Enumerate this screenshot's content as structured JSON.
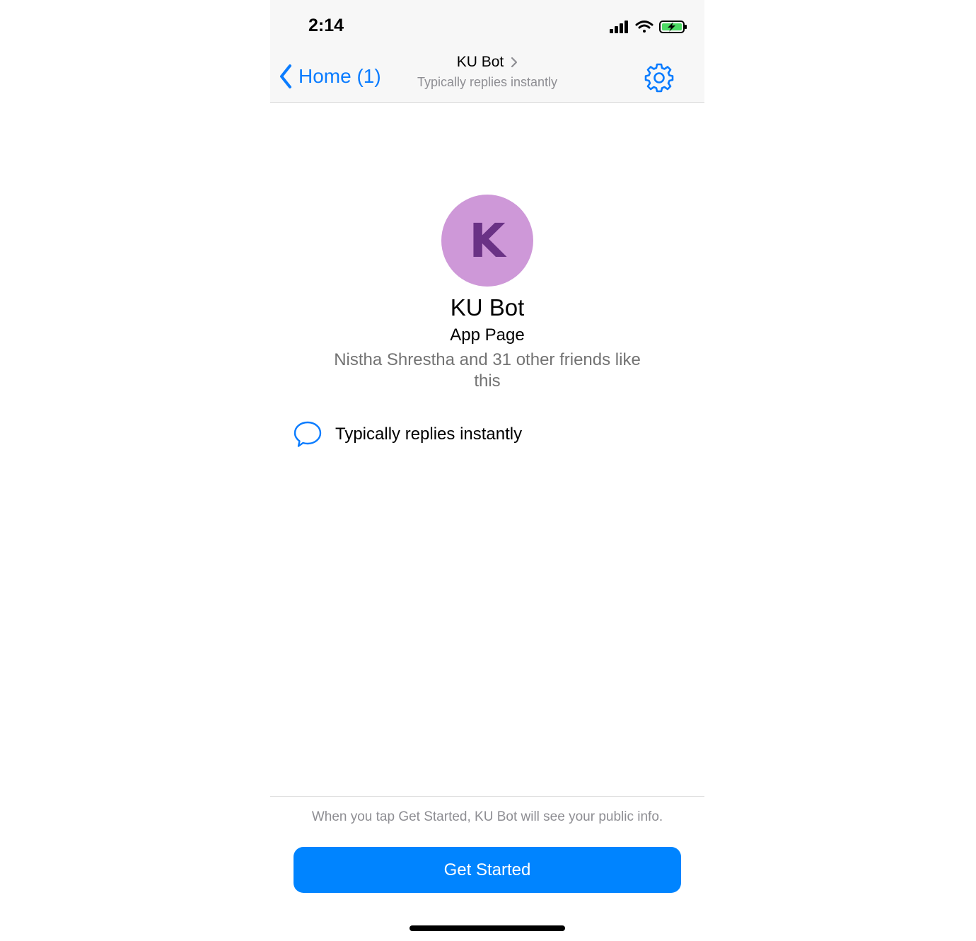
{
  "status_bar": {
    "time": "2:14",
    "icons": [
      "cellular-signal-icon",
      "wifi-icon",
      "battery-charging-icon"
    ],
    "battery_color": "#4cd964"
  },
  "nav": {
    "back_label": "Home (1)",
    "title": "KU Bot",
    "subtitle": "Typically replies instantly",
    "settings_icon": "gear-icon"
  },
  "profile": {
    "avatar_letter": "K",
    "avatar_bg": "#ce98d8",
    "avatar_fg": "#6a3285",
    "name": "KU Bot",
    "category": "App Page",
    "likes": "Nistha Shrestha and 31 other friends like this",
    "reply_info": "Typically replies instantly"
  },
  "footer": {
    "note": "When you tap Get Started, KU Bot will see your public info.",
    "button_label": "Get Started"
  },
  "colors": {
    "accent": "#0a7cff",
    "button": "#0084ff"
  }
}
